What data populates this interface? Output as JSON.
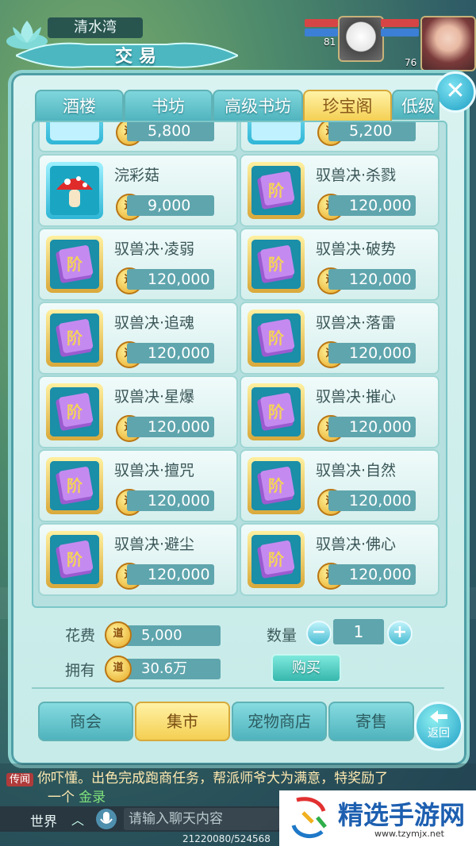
{
  "hud": {
    "location": "清水湾",
    "pet_level": "81",
    "player_level": "76"
  },
  "panel": {
    "title": "交易",
    "close_label": "✕"
  },
  "tabs": [
    {
      "label": "酒楼",
      "active": false
    },
    {
      "label": "书坊",
      "active": false
    },
    {
      "label": "高级书坊",
      "active": false
    },
    {
      "label": "珍宝阁",
      "active": true
    },
    {
      "label": "低级兑",
      "active": false
    }
  ],
  "items_partial": [
    {
      "price": "5,800"
    },
    {
      "price": "5,200"
    }
  ],
  "items": [
    {
      "name": "浣彩菇",
      "price": "9,000",
      "icon": "mushroom-icon"
    },
    {
      "name": "驭兽决·杀戮",
      "price": "120,000",
      "icon": "skill-book-icon"
    },
    {
      "name": "驭兽决·凌弱",
      "price": "120,000",
      "icon": "skill-book-icon"
    },
    {
      "name": "驭兽决·破势",
      "price": "120,000",
      "icon": "skill-book-icon"
    },
    {
      "name": "驭兽决·追魂",
      "price": "120,000",
      "icon": "skill-book-icon"
    },
    {
      "name": "驭兽决·落雷",
      "price": "120,000",
      "icon": "skill-book-icon"
    },
    {
      "name": "驭兽决·星爆",
      "price": "120,000",
      "icon": "skill-book-icon"
    },
    {
      "name": "驭兽决·摧心",
      "price": "120,000",
      "icon": "skill-book-icon"
    },
    {
      "name": "驭兽决·擅咒",
      "price": "120,000",
      "icon": "skill-book-icon"
    },
    {
      "name": "驭兽决·自然",
      "price": "120,000",
      "icon": "skill-book-icon"
    },
    {
      "name": "驭兽决·避尘",
      "price": "120,000",
      "icon": "skill-book-icon"
    },
    {
      "name": "驭兽决·佛心",
      "price": "120,000",
      "icon": "skill-book-icon"
    }
  ],
  "coin_glyph": "道",
  "summary": {
    "cost_label": "花费",
    "cost_value": "5,000",
    "own_label": "拥有",
    "own_value": "30.6万",
    "qty_label": "数量",
    "qty_value": "1",
    "minus": "−",
    "plus": "+",
    "buy_label": "购买"
  },
  "bottom_nav": [
    {
      "label": "商会",
      "active": false
    },
    {
      "label": "集市",
      "active": true
    },
    {
      "label": "宠物商店",
      "active": false
    },
    {
      "label": "寄售",
      "active": false
    }
  ],
  "back_label": "返回",
  "chat": {
    "tag": "传闻",
    "message": "你吓懂。出色完成跑商任务，帮派师爷大为满意，特奖励了",
    "message2": "一个",
    "highlight": "金录",
    "channel": "世界",
    "placeholder": "请输入聊天内容",
    "coords": "21220080/524568"
  },
  "watermark": {
    "brand": "精选手游网",
    "url": "www.tzymjx.net"
  },
  "colors": {
    "panel": "#c6ebe8",
    "tab_active": "#f4cf52",
    "price_bar": "#5fa5ad"
  }
}
